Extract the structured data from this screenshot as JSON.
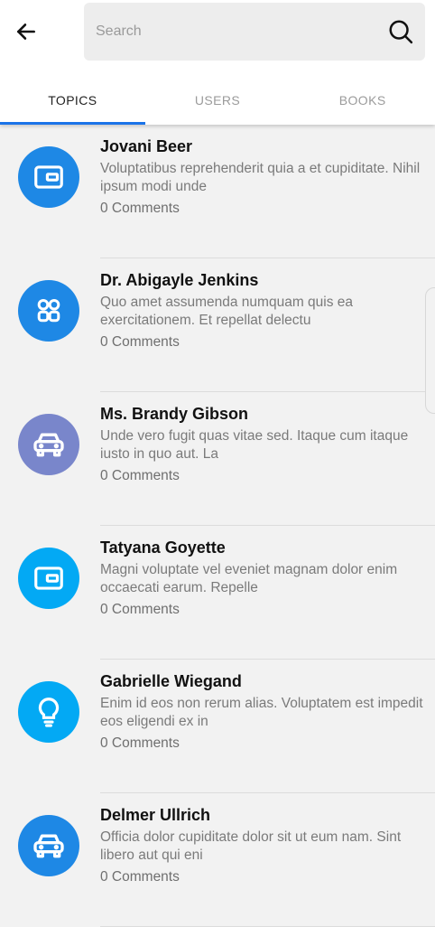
{
  "search": {
    "placeholder": "Search"
  },
  "tabs": [
    {
      "label": "TOPICS",
      "active": true
    },
    {
      "label": "USERS",
      "active": false
    },
    {
      "label": "BOOKS",
      "active": false
    }
  ],
  "colors": {
    "accent": "#1a73e8",
    "blue": "#1e88e5",
    "lavender": "#7986cb",
    "cyan": "#03a9f4"
  },
  "topics": [
    {
      "name": "Jovani Beer",
      "desc": "Voluptatibus reprehenderit quia a et cupiditate. Nihil ipsum modi unde",
      "comments": "0 Comments",
      "icon": "wallet-icon",
      "color": "#1e88e5"
    },
    {
      "name": "Dr. Abigayle Jenkins",
      "desc": "Quo amet assumenda numquam quis ea exercitationem. Et repellat delectu",
      "comments": "0 Comments",
      "icon": "apps-icon",
      "color": "#1e88e5"
    },
    {
      "name": "Ms. Brandy Gibson",
      "desc": "Unde vero fugit quas vitae sed. Itaque cum itaque iusto in quo aut. La",
      "comments": "0 Comments",
      "icon": "car-icon",
      "color": "#7986cb"
    },
    {
      "name": "Tatyana Goyette",
      "desc": "Magni voluptate vel eveniet magnam dolor enim occaecati earum. Repelle",
      "comments": "0 Comments",
      "icon": "wallet-icon",
      "color": "#03a9f4"
    },
    {
      "name": "Gabrielle Wiegand",
      "desc": "Enim id eos non rerum alias. Voluptatem est impedit eos eligendi ex in",
      "comments": "0 Comments",
      "icon": "lightbulb-icon",
      "color": "#03a9f4"
    },
    {
      "name": "Delmer Ullrich",
      "desc": "Officia dolor cupiditate dolor sit ut eum nam. Sint libero aut qui eni",
      "comments": "0 Comments",
      "icon": "car-icon",
      "color": "#1e88e5"
    }
  ]
}
